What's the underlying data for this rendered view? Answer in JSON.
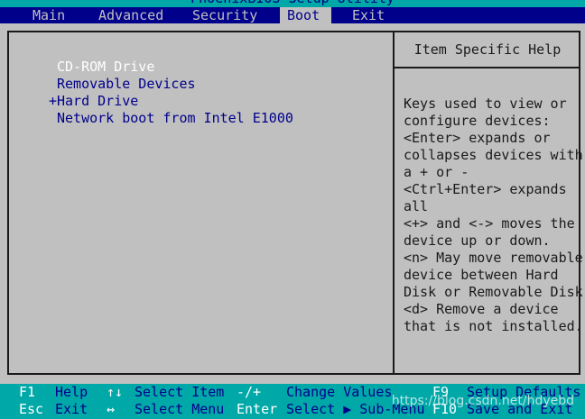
{
  "title": "PhoenixBIOS Setup Utility",
  "menu": [
    {
      "label": "Main",
      "active": false
    },
    {
      "label": "Advanced",
      "active": false
    },
    {
      "label": "Security",
      "active": false
    },
    {
      "label": "Boot",
      "active": true
    },
    {
      "label": "Exit",
      "active": false
    }
  ],
  "boot_devices": [
    {
      "prefix": " ",
      "label": "CD-ROM Drive",
      "selected": true
    },
    {
      "prefix": " ",
      "label": "Removable Devices",
      "selected": false
    },
    {
      "prefix": "+",
      "label": "Hard Drive",
      "selected": false
    },
    {
      "prefix": " ",
      "label": "Network boot from Intel E1000",
      "selected": false
    }
  ],
  "help": {
    "title": "Item Specific Help",
    "lines": [
      "Keys used to view or",
      "configure devices:",
      "<Enter> expands or",
      "collapses devices with",
      "a + or -",
      "<Ctrl+Enter> expands",
      "all",
      "<+> and <-> moves the",
      "device up or down.",
      "<n> May move removable",
      "device between Hard",
      "Disk or Removable Disk",
      "<d> Remove a device",
      "that is not installed."
    ]
  },
  "keys": {
    "row1": [
      {
        "key": "F1",
        "desc": "Help"
      },
      {
        "key": "↑↓",
        "desc": "Select Item"
      },
      {
        "key": "-/+",
        "desc": "Change Values"
      },
      {
        "key": "F9",
        "desc": "Setup Defaults"
      }
    ],
    "row2": [
      {
        "key": "Esc",
        "desc": "Exit"
      },
      {
        "key": "↔",
        "desc": "Select Menu"
      },
      {
        "key": "Enter",
        "desc": "Select ▶ Sub-Menu"
      },
      {
        "key": "F10",
        "desc": "Save and Exit"
      }
    ]
  },
  "watermark": "https://blog.csdn.net/hdyebd",
  "colors": {
    "background": "#c0c0c0",
    "menu_bar": "#00008a",
    "title_bar": "#00a8a8",
    "highlight_text": "#ffffff",
    "normal_text": "#00008a",
    "panel_text": "#1a1a1a"
  }
}
